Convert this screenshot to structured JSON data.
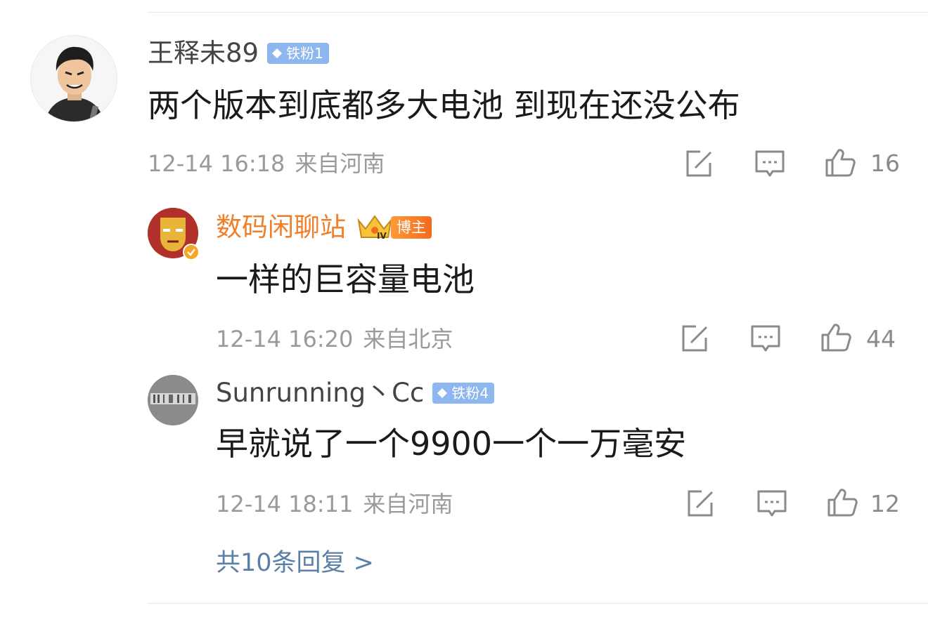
{
  "comments": [
    {
      "username": "王释未89",
      "badge": "铁粉1",
      "text": "两个版本到底都多大电池 到现在还没公布",
      "time": "12-14 16:18",
      "location": "来自河南",
      "likes": "16"
    },
    {
      "username": "数码闲聊站",
      "badge": "博主",
      "crown_level": "IV",
      "text": "一样的巨容量电池",
      "time": "12-14 16:20",
      "location": "来自北京",
      "likes": "44"
    },
    {
      "username": "Sunrunning丶Cc",
      "badge": "铁粉4",
      "text": "早就说了一个9900一个一万毫安",
      "time": "12-14 18:11",
      "location": "来自河南",
      "likes": "12"
    }
  ],
  "more_replies": "共10条回复 >",
  "colors": {
    "blogger_name": "#f07f2a",
    "fan_badge": "#8fb7ef",
    "link": "#5b7fa6",
    "meta_text": "#9a9a9a"
  },
  "icons": {
    "repost": "share-edit-icon",
    "comment": "comment-bubble-icon",
    "like": "thumbs-up-icon",
    "fan_badge": "diamond-icon",
    "blogger": "crown-icon",
    "verified": "verified-check-icon"
  }
}
